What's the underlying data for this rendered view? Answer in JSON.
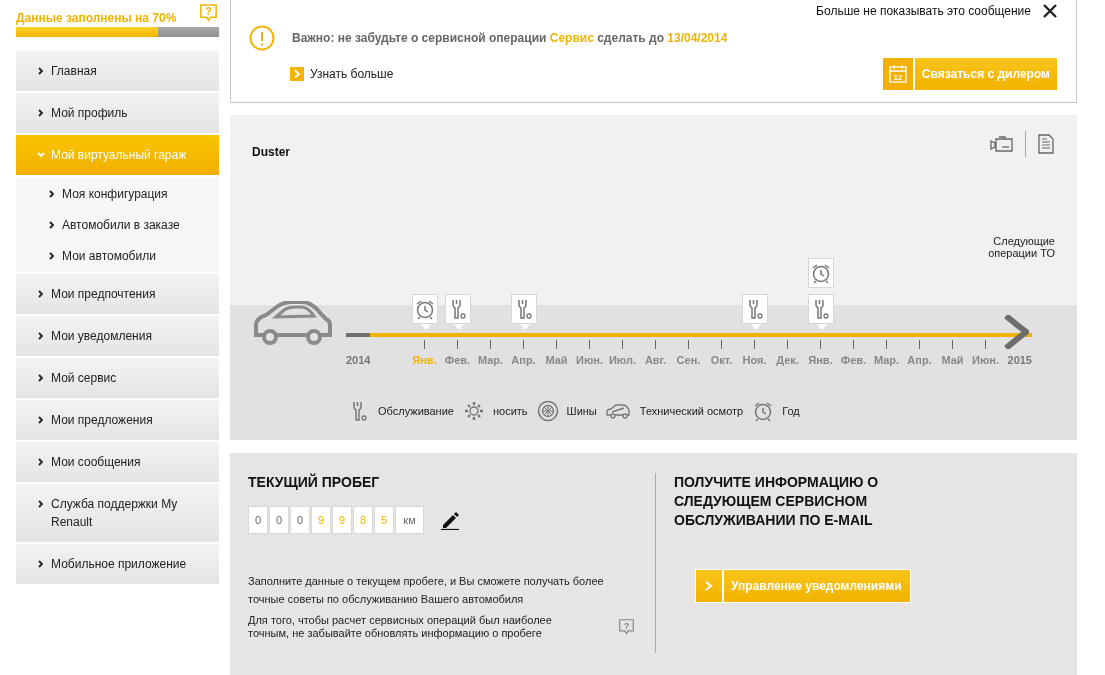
{
  "profile_progress": {
    "label": "Данные заполнены на 70%",
    "level": 0.7,
    "help_mark": "?"
  },
  "menu": [
    {
      "label": "Главная",
      "selected": false,
      "expanded": false
    },
    {
      "label": "Мой профиль",
      "selected": false,
      "expanded": false
    },
    {
      "label": "Мой виртуальный гараж",
      "selected": true,
      "expanded": true,
      "children": [
        {
          "label": "Моя конфигурация",
          "selected": false
        },
        {
          "label": "Автомобили в заказе",
          "selected": false
        },
        {
          "label": "Мои автомобили",
          "selected": false
        }
      ]
    },
    {
      "label": "Мои предпочтения",
      "selected": false,
      "expanded": false
    },
    {
      "label": "Мои уведомления",
      "selected": false,
      "expanded": false
    },
    {
      "label": "Мой сервис",
      "selected": false,
      "expanded": false
    },
    {
      "label": "Мои предложения",
      "selected": false,
      "expanded": false
    },
    {
      "label": "Мои сообщения",
      "selected": false,
      "expanded": false
    },
    {
      "label": "Служба поддержки My Renault",
      "selected": false,
      "expanded": false
    },
    {
      "label": "Мобильное приложение",
      "selected": false,
      "expanded": false
    }
  ],
  "alert": {
    "dismiss": "Больше не показывать это сообщение",
    "message": [
      {
        "text": "Важно: не забудьте о сервисной операции ",
        "highlight": false
      },
      {
        "text": "Сервис",
        "highlight": true
      },
      {
        "text": " сделать до ",
        "highlight": false
      },
      {
        "text": "13/04/2014",
        "highlight": true
      }
    ],
    "more_link": "Узнать больше",
    "calendar_day": "12",
    "contact_button": "Связаться с дилером"
  },
  "timeline": {
    "car": "Duster",
    "next_label": "Следующие операции ТО",
    "start_year": "2014",
    "end_year": "2015",
    "months": [
      {
        "label": "Янв.",
        "current": true,
        "events": [
          {
            "kind": "year"
          }
        ]
      },
      {
        "label": "Фев.",
        "current": false,
        "events": [
          {
            "kind": "maintenance"
          }
        ]
      },
      {
        "label": "Мар.",
        "current": false
      },
      {
        "label": "Апр.",
        "current": false,
        "events": [
          {
            "kind": "maintenance"
          }
        ]
      },
      {
        "label": "Май",
        "current": false
      },
      {
        "label": "Июн.",
        "current": false
      },
      {
        "label": "Июл.",
        "current": false
      },
      {
        "label": "Авг.",
        "current": false
      },
      {
        "label": "Сен.",
        "current": false
      },
      {
        "label": "Окт.",
        "current": false
      },
      {
        "label": "Ноя.",
        "current": false,
        "events": [
          {
            "kind": "maintenance"
          }
        ]
      },
      {
        "label": "Дек.",
        "current": false
      },
      {
        "label": "Янв.",
        "current": false,
        "events": [
          {
            "kind": "year"
          },
          {
            "kind": "maintenance"
          }
        ]
      },
      {
        "label": "Фев.",
        "current": false
      },
      {
        "label": "Мар.",
        "current": false
      },
      {
        "label": "Апр.",
        "current": false
      },
      {
        "label": "Май",
        "current": false
      },
      {
        "label": "Июн.",
        "current": false
      }
    ],
    "legend": [
      {
        "kind": "maintenance",
        "label": "Обслуживание"
      },
      {
        "kind": "wear",
        "label": "носить"
      },
      {
        "kind": "tires",
        "label": "Шины"
      },
      {
        "kind": "inspection",
        "label": "Технический осмотр"
      },
      {
        "kind": "year",
        "label": "Год"
      }
    ]
  },
  "mileage": {
    "title": "ТЕКУЩИЙ ПРОБЕГ",
    "digits": [
      {
        "value": "0",
        "filled": false
      },
      {
        "value": "0",
        "filled": false
      },
      {
        "value": "0",
        "filled": false
      },
      {
        "value": "9",
        "filled": true
      },
      {
        "value": "9",
        "filled": true
      },
      {
        "value": "8",
        "filled": true
      },
      {
        "value": "5",
        "filled": true
      }
    ],
    "unit": "км",
    "hint": "Заполните данные о текущем пробеге, и Вы сможете получать более точные советы по обслуживанию Вашего автомобиля",
    "reminder": "Для того, чтобы расчет сервисных операций был наиболее точным, не забывайте обновлять информацию о пробеге",
    "help_mark": "?"
  },
  "email_info": {
    "title": "ПОЛУЧИТЕ ИНФОРМАЦИЮ О СЛЕДУЮЩЕМ СЕРВИСНОМ ОБСЛУЖИВАНИИ ПО E-MAIL",
    "button": "Управление уведомлениями"
  }
}
